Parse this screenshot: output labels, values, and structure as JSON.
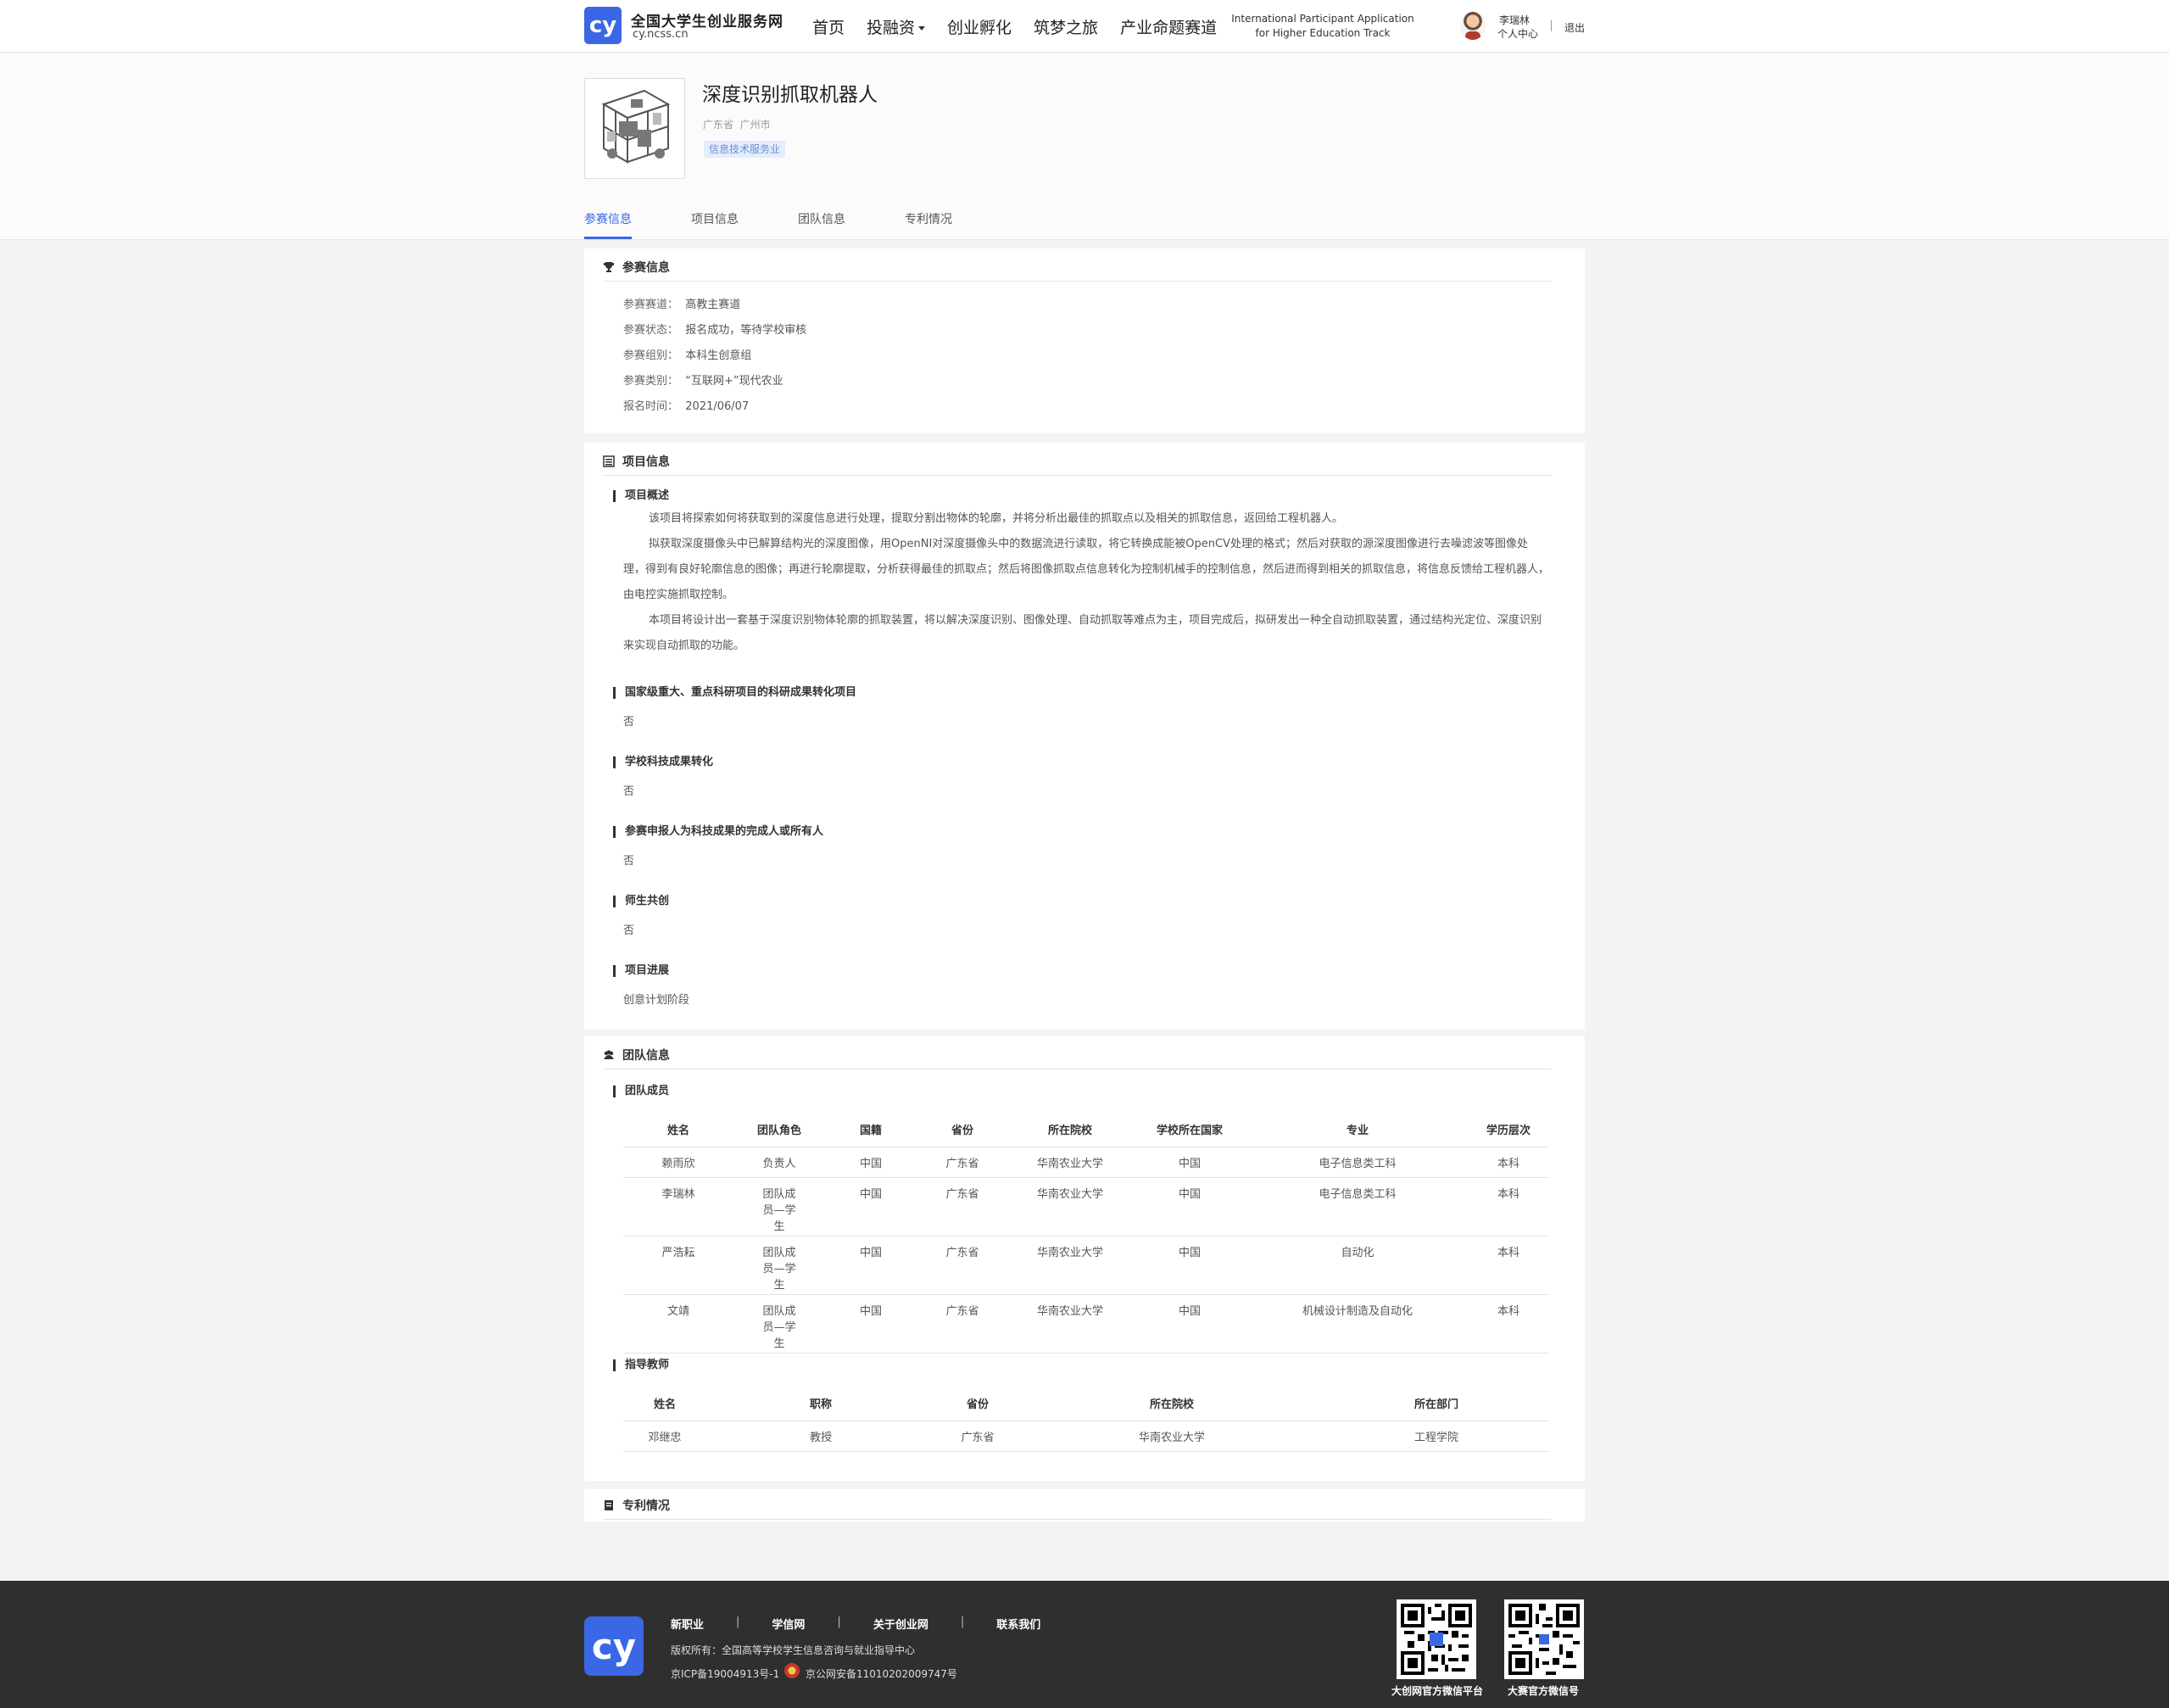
{
  "header": {
    "logo_text": "cy",
    "site_name": "全国大学生创业服务网",
    "site_url": "cy.ncss.cn",
    "nav": [
      "首页",
      "投融资",
      "创业孵化",
      "筑梦之旅",
      "产业命题赛道"
    ],
    "intl_line1": "International Participant Application",
    "intl_line2": "for Higher Education Track",
    "user_name": "李瑞林",
    "user_center": "个人中心",
    "logout": "退出"
  },
  "project": {
    "title": "深度识别抓取机器人",
    "province": "广东省",
    "city": "广州市",
    "tag": "信息技术服务业",
    "tabs": [
      "参赛信息",
      "项目信息",
      "团队信息",
      "专利情况"
    ]
  },
  "entry_info": {
    "title": "参赛信息",
    "rows": [
      {
        "k": "参赛赛道：",
        "v": "高教主赛道"
      },
      {
        "k": "参赛状态：",
        "v": "报名成功，等待学校审核"
      },
      {
        "k": "参赛组别：",
        "v": "本科生创意组"
      },
      {
        "k": "参赛类别：",
        "v": "“互联网+”现代农业"
      },
      {
        "k": "报名时间：",
        "v": "2021/06/07"
      }
    ]
  },
  "project_info": {
    "title": "项目信息",
    "overview_title": "项目概述",
    "overview_p1": "该项目将探索如何将获取到的深度信息进行处理，提取分割出物体的轮廓，并将分析出最佳的抓取点以及相关的抓取信息，返回给工程机器人。",
    "overview_p2": "拟获取深度摄像头中已解算结构光的深度图像，用OpenNI对深度摄像头中的数据流进行读取，将它转换成能被OpenCV处理的格式；然后对获取的源深度图像进行去噪滤波等图像处理，得到有良好轮廓信息的图像；再进行轮廓提取，分析获得最佳的抓取点；然后将图像抓取点信息转化为控制机械手的控制信息，然后进而得到相关的抓取信息，将信息反馈给工程机器人，由电控实施抓取控制。",
    "overview_p3": "本项目将设计出一套基于深度识别物体轮廓的抓取装置，将以解决深度识别、图像处理、自动抓取等难点为主，项目完成后，拟研发出一种全自动抓取装置，通过结构光定位、深度识别来实现自动抓取的功能。",
    "items": [
      {
        "label": "国家级重大、重点科研项目的科研成果转化项目",
        "value": "否"
      },
      {
        "label": "学校科技成果转化",
        "value": "否"
      },
      {
        "label": "参赛申报人为科技成果的完成人或所有人",
        "value": "否"
      },
      {
        "label": "师生共创",
        "value": "否"
      },
      {
        "label": "项目进展",
        "value": "创意计划阶段"
      }
    ]
  },
  "team_info": {
    "title": "团队信息",
    "members_title": "团队成员",
    "member_headers": [
      "姓名",
      "团队角色",
      "国籍",
      "省份",
      "所在院校",
      "学校所在国家",
      "专业",
      "学历层次"
    ],
    "members": [
      [
        "赖雨欣",
        "负责人",
        "中国",
        "广东省",
        "华南农业大学",
        "中国",
        "电子信息类工科",
        "本科"
      ],
      [
        "李瑞林",
        "团队成员—学生",
        "中国",
        "广东省",
        "华南农业大学",
        "中国",
        "电子信息类工科",
        "本科"
      ],
      [
        "严浩耘",
        "团队成员—学生",
        "中国",
        "广东省",
        "华南农业大学",
        "中国",
        "自动化",
        "本科"
      ],
      [
        "文靖",
        "团队成员—学生",
        "中国",
        "广东省",
        "华南农业大学",
        "中国",
        "机械设计制造及自动化",
        "本科"
      ]
    ],
    "advisor_title": "指导教师",
    "advisor_headers": [
      "姓名",
      "职称",
      "省份",
      "所在院校",
      "所在部门"
    ],
    "advisors": [
      [
        "邓继忠",
        "教授",
        "广东省",
        "华南农业大学",
        "工程学院"
      ]
    ]
  },
  "patent": {
    "title": "专利情况"
  },
  "footer": {
    "links": [
      "新职业",
      "学信网",
      "关于创业网",
      "联系我们"
    ],
    "copyright": "版权所有：全国高等学校学生信息咨询与就业指导中心",
    "icp": "京ICP备19004913号-1",
    "police": "京公网安备11010202009747号",
    "qr1_caption": "大创网官方微信平台",
    "qr2_caption": "大赛官方微信号"
  },
  "colors": {
    "accent": "#3a67e6",
    "footer_bg": "#2f2f2f",
    "tag_bg": "#e4edfc"
  }
}
